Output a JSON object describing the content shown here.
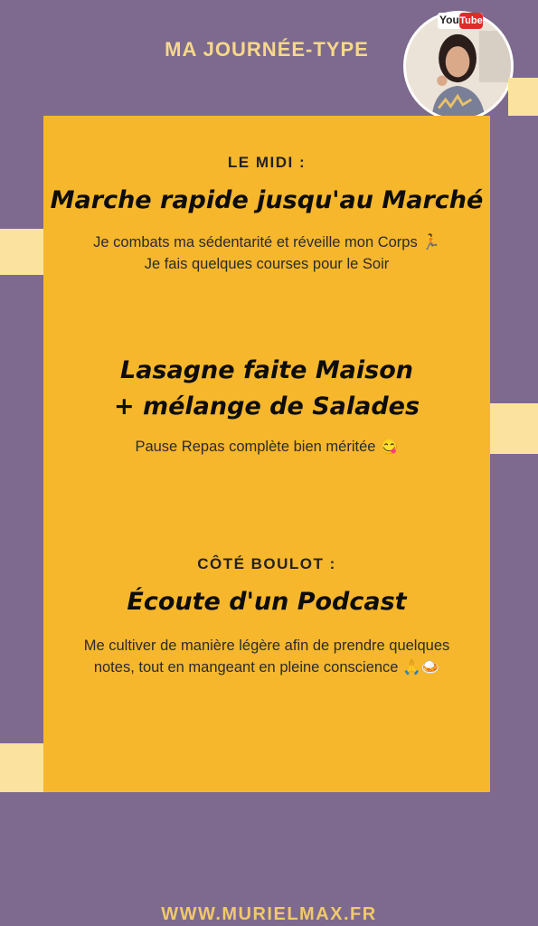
{
  "header": {
    "title": "MA JOURNÉE-TYPE",
    "avatar_badge": "YouTube"
  },
  "sections": [
    {
      "heading": "LE MIDI :",
      "headline": "Marche rapide jusqu'au Marché",
      "lines": [
        "Je combats ma sédentarité et réveille mon Corps 🏃",
        "Je fais quelques courses pour le Soir"
      ]
    },
    {
      "heading": "",
      "headline_lines": [
        "Lasagne faite Maison",
        "+ mélange de Salades"
      ],
      "lines": [
        "Pause Repas complète bien méritée 😋"
      ]
    },
    {
      "heading": "CÔTÉ BOULOT :",
      "headline": "Écoute d'un Podcast",
      "lines": [
        "Me cultiver de manière légère afin de prendre quelques",
        "notes, tout en mangeant en pleine conscience 🙏🍛"
      ]
    }
  ],
  "footer": {
    "url": "WWW.MURIELMAX.FR"
  },
  "colors": {
    "background": "#7d6a8e",
    "card": "#f6b72d",
    "accent": "#fbe39f",
    "title": "#f7d889"
  }
}
